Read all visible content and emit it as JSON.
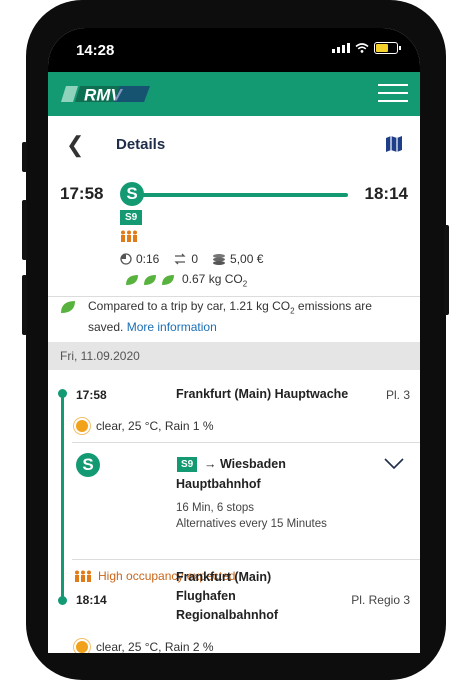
{
  "status": {
    "time": "14:28"
  },
  "appbar": {
    "logo_text": "RMV",
    "brand_color": "#139a73"
  },
  "nav": {
    "title": "Details"
  },
  "summary": {
    "departure": "17:58",
    "arrival": "18:14",
    "line": "S9",
    "duration": "0:16",
    "transfers": "0",
    "price": "5,00 €",
    "co2": "0.67 kg CO",
    "co2_sub": "2"
  },
  "notice": {
    "text_a": "Compared to a trip by car, 1.21 kg CO",
    "text_sub": "2",
    "text_b": " emissions are saved. ",
    "link": "More information"
  },
  "date": "Fri, 11.09.2020",
  "origin": {
    "time": "17:58",
    "name": "Frankfurt (Main) Hauptwache",
    "platform": "Pl. 3",
    "weather": "clear, 25 °C, Rain 1 %"
  },
  "leg": {
    "line": "S9",
    "direction": "→ Wiesbaden Hauptbahnhof",
    "info1": "16 Min, 6 stops",
    "info2": "Alternatives every 15 Minutes",
    "occupancy": "High occupancy expected"
  },
  "destination": {
    "time": "18:14",
    "name_line1": "Frankfurt (Main)",
    "name_line2": "Flughafen",
    "name_line3": "Regionalbahnhof",
    "platform": "Pl. Regio 3",
    "weather": "clear, 25 °C, Rain 2 %"
  }
}
